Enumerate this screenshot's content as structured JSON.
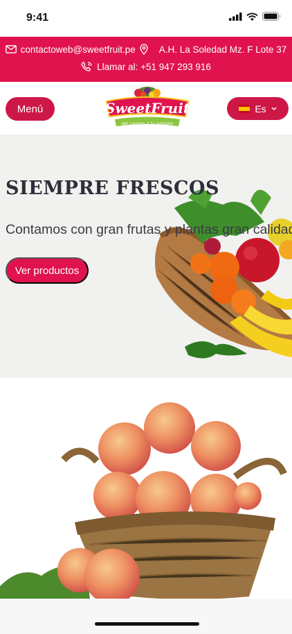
{
  "status": {
    "time": "9:41"
  },
  "contact": {
    "email": "contactoweb@sweetfruit.pe",
    "address": "A.H. La Soledad Mz. F Lote 37",
    "phone": "Llamar al: +51 947 293 916"
  },
  "header": {
    "menu_label": "Menú",
    "logo_name": "SweetFruit",
    "logo_tagline": "del campo a tu paladar",
    "lang_label": "Es"
  },
  "hero": {
    "title": "SIEMPRE FRESCOS",
    "subtitle": "Contamos con gran frutas y plantas gran calidad",
    "cta_label": "Ver productos"
  },
  "colors": {
    "brand": "#e0134f",
    "button": "#cd1747"
  }
}
